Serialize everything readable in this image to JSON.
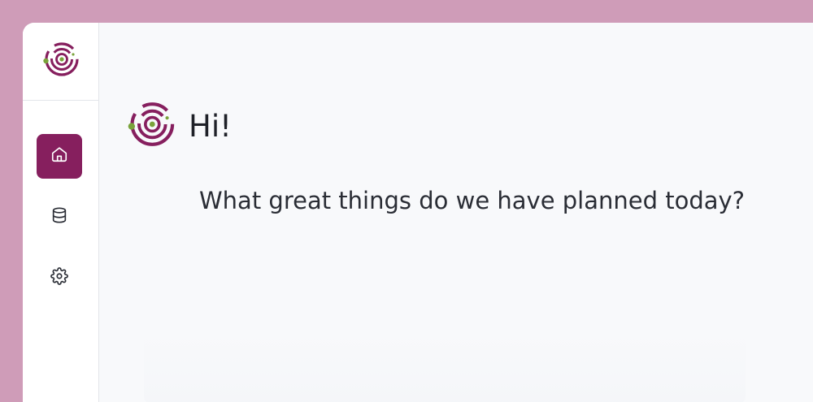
{
  "app": {
    "logo_icon": "concentric-rings-logo",
    "brand_color": "#861f5e",
    "accent_color": "#7aa33b"
  },
  "sidebar": {
    "items": [
      {
        "id": "home",
        "icon": "home-icon",
        "active": true
      },
      {
        "id": "data",
        "icon": "database-icon",
        "active": false
      },
      {
        "id": "settings",
        "icon": "gear-icon",
        "active": false
      }
    ]
  },
  "main": {
    "greeting": "Hi!",
    "subtitle": "What great things do we have planned today?"
  }
}
